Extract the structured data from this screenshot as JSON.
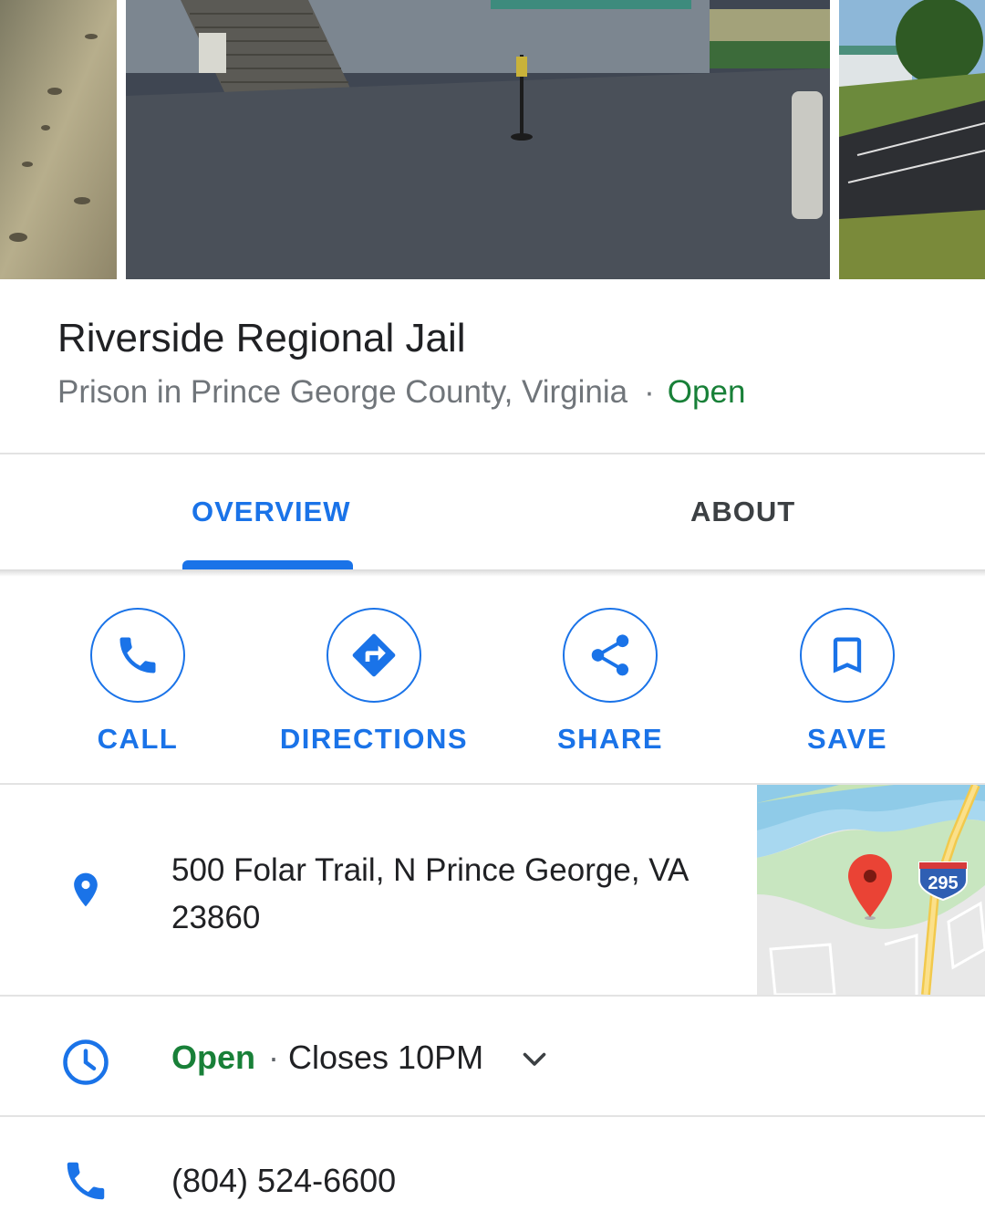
{
  "place": {
    "name": "Riverside Regional Jail",
    "category": "Prison in Prince George County, Virginia",
    "separator": "·",
    "status": "Open"
  },
  "tabs": [
    {
      "label": "OVERVIEW",
      "selected": true
    },
    {
      "label": "ABOUT",
      "selected": false
    }
  ],
  "actions": {
    "call": "CALL",
    "directions": "DIRECTIONS",
    "share": "SHARE",
    "save": "SAVE"
  },
  "address": {
    "line": "500 Folar Trail, N Prince George, VA 23860",
    "map_shield": "295"
  },
  "hours": {
    "status": "Open",
    "separator": "·",
    "closes": "Closes 10PM"
  },
  "phone": "(804) 524-6600",
  "icons": {
    "call": "phone-icon",
    "directions": "directions-icon",
    "share": "share-icon",
    "save": "bookmark-icon",
    "address": "location-pin-icon",
    "hours": "clock-icon",
    "hours_expand": "chevron-down-icon",
    "phone": "phone-icon"
  },
  "colors": {
    "accent": "#1a73e8",
    "open": "#188038",
    "map_pin": "#ea4335"
  }
}
